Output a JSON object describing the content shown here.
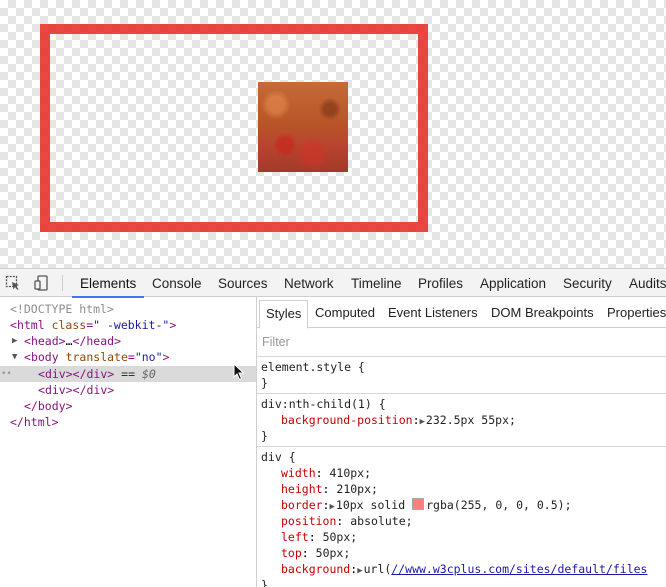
{
  "devtools": {
    "tabs": [
      "Elements",
      "Console",
      "Sources",
      "Network",
      "Timeline",
      "Profiles",
      "Application",
      "Security",
      "Audits"
    ],
    "active_tab": "Elements",
    "icons": [
      "inspect-element-icon",
      "device-mode-icon"
    ]
  },
  "dom_tree": {
    "doctype": "<!DOCTYPE html>",
    "html_tag": "html",
    "html_attr_name": "class",
    "html_attr_value": "\" -webkit-\"",
    "head_tag": "head",
    "head_ellipsis": "…",
    "body_tag": "body",
    "body_attr_name": "translate",
    "body_attr_value": "\"no\"",
    "div_tag": "div",
    "selected_marker": "==",
    "selected_ref": "$0"
  },
  "styles_pane": {
    "subtabs": [
      "Styles",
      "Computed",
      "Event Listeners",
      "DOM Breakpoints",
      "Properties"
    ],
    "active_subtab": "Styles",
    "filter_placeholder": "Filter",
    "rules": {
      "element_style": {
        "selector": "element.style {",
        "close": "}"
      },
      "nth_child": {
        "selector": "div:nth-child(1) {",
        "props": [
          {
            "name": "background-position",
            "value": "232.5px 55px;"
          }
        ],
        "close": "}"
      },
      "div": {
        "selector": "div {",
        "props": [
          {
            "name": "width",
            "value": "410px;"
          },
          {
            "name": "height",
            "value": "210px;"
          },
          {
            "name": "border",
            "value_pre": "10px solid",
            "value_post": "rgba(255, 0, 0, 0.5);"
          },
          {
            "name": "position",
            "value": "absolute;"
          },
          {
            "name": "left",
            "value": "50px;"
          },
          {
            "name": "top",
            "value": "50px;"
          },
          {
            "name": "background",
            "value_pre": "url(",
            "link": "//www.w3cplus.com/sites/default/files"
          }
        ],
        "close": "}"
      }
    }
  },
  "colors": {
    "red_box_border": "#e6281e",
    "swatch": "rgba(255, 0, 0, 0.5)",
    "active_tab_underline": "#3b7be9"
  }
}
